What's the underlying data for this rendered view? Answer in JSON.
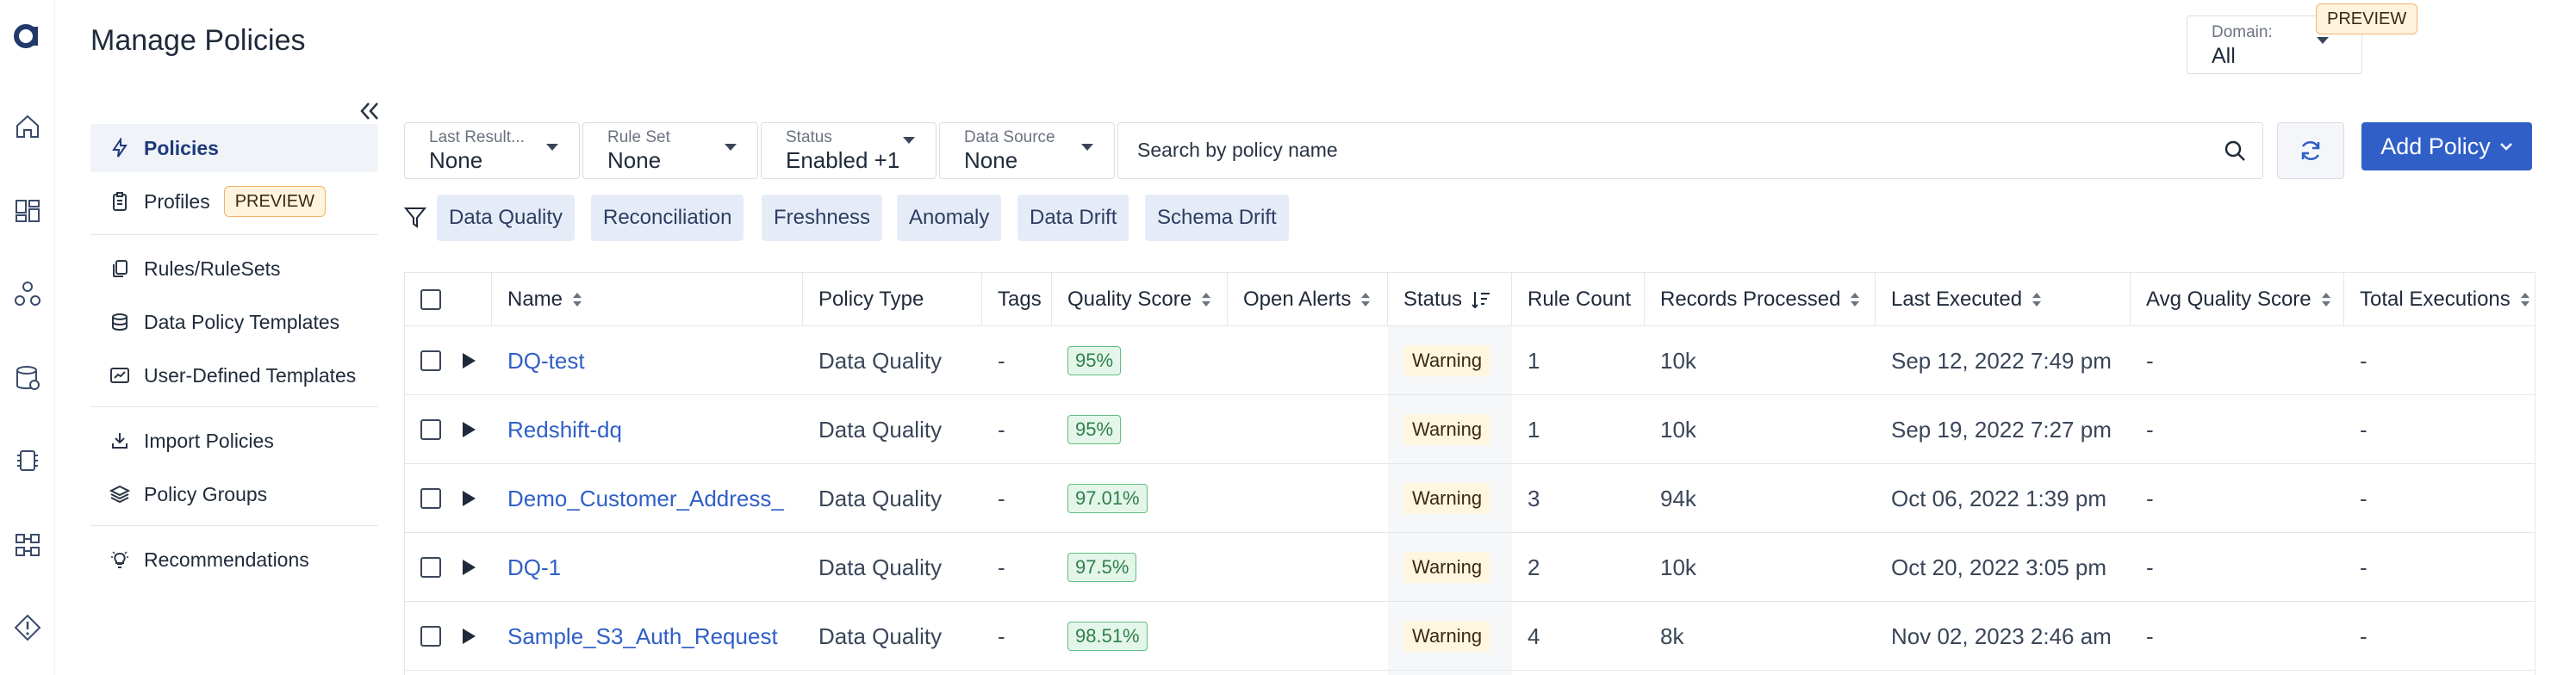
{
  "app": {
    "title": "Manage Policies",
    "logo": "a"
  },
  "rail": {
    "icons": [
      "home-icon",
      "dashboard-icon",
      "network-icon",
      "database-icon",
      "chip-icon",
      "workflow-icon",
      "alert-diamond-icon"
    ]
  },
  "domain": {
    "label": "Domain:",
    "value": "All",
    "badge": "PREVIEW"
  },
  "subnav": {
    "items": [
      {
        "label": "Policies",
        "icon": "bolt-icon",
        "active": true
      },
      {
        "label": "Profiles",
        "icon": "clipboard-icon",
        "badge": "PREVIEW"
      },
      {
        "label": "Rules/RuleSets",
        "icon": "copy-icon"
      },
      {
        "label": "Data Policy Templates",
        "icon": "database-icon"
      },
      {
        "label": "User-Defined Templates",
        "icon": "chart-window-icon"
      },
      {
        "label": "Import Policies",
        "icon": "import-icon"
      },
      {
        "label": "Policy Groups",
        "icon": "layers-icon"
      },
      {
        "label": "Recommendations",
        "icon": "lightbulb-icon"
      }
    ]
  },
  "filters": {
    "last_result": {
      "label": "Last Result...",
      "value": "None"
    },
    "rule_set": {
      "label": "Rule Set",
      "value": "None"
    },
    "status": {
      "label": "Status",
      "value": "Enabled +1"
    },
    "data_source": {
      "label": "Data Source",
      "value": "None"
    },
    "search_placeholder": "Search by policy name",
    "add_policy": "Add Policy"
  },
  "chips": [
    "Data Quality",
    "Reconciliation",
    "Freshness",
    "Anomaly",
    "Data Drift",
    "Schema Drift"
  ],
  "table": {
    "columns": [
      "Name",
      "Policy Type",
      "Tags",
      "Quality Score",
      "Open Alerts",
      "Status",
      "Rule Count",
      "Records Processed",
      "Last Executed",
      "Avg Quality Score",
      "Total Executions"
    ],
    "rows": [
      {
        "name": "DQ-test",
        "type": "Data Quality",
        "tags": "-",
        "score": "95%",
        "alerts": "",
        "status": "Warning",
        "rules": "1",
        "records": "10k",
        "last": "Sep 12, 2022 7:49 pm",
        "avg": "-",
        "total": "-"
      },
      {
        "name": "Redshift-dq",
        "type": "Data Quality",
        "tags": "-",
        "score": "95%",
        "alerts": "",
        "status": "Warning",
        "rules": "1",
        "records": "10k",
        "last": "Sep 19, 2022 7:27 pm",
        "avg": "-",
        "total": "-"
      },
      {
        "name": "Demo_Customer_Address_",
        "type": "Data Quality",
        "tags": "-",
        "score": "97.01%",
        "alerts": "",
        "status": "Warning",
        "rules": "3",
        "records": "94k",
        "last": "Oct 06, 2022 1:39 pm",
        "avg": "-",
        "total": "-"
      },
      {
        "name": "DQ-1",
        "type": "Data Quality",
        "tags": "-",
        "score": "97.5%",
        "alerts": "",
        "status": "Warning",
        "rules": "2",
        "records": "10k",
        "last": "Oct 20, 2022 3:05 pm",
        "avg": "-",
        "total": "-"
      },
      {
        "name": "Sample_S3_Auth_Request",
        "type": "Data Quality",
        "tags": "-",
        "score": "98.51%",
        "alerts": "",
        "status": "Warning",
        "rules": "4",
        "records": "8k",
        "last": "Nov 02, 2023 2:46 am",
        "avg": "-",
        "total": "-"
      }
    ]
  },
  "colors": {
    "primary": "#2f5fc7",
    "chip_bg": "#e6ecf7",
    "score_green": "#2f7f4a",
    "warning_bg": "#fff6e0",
    "preview_border": "#f3b36a"
  }
}
